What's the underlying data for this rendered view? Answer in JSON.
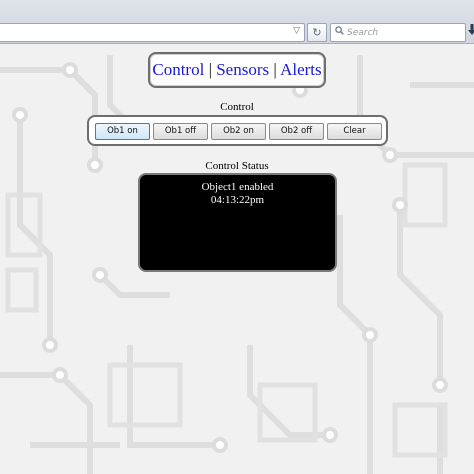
{
  "browser": {
    "search_placeholder": "Search",
    "reload_glyph": "↻",
    "dropdown_glyph": "▽",
    "search_icon": "magnifier-icon",
    "download_icon": "download-icon"
  },
  "nav": {
    "items": [
      {
        "label": "Control"
      },
      {
        "label": "Sensors"
      },
      {
        "label": "Alerts"
      }
    ],
    "separator": "|",
    "link_color": "#1a1ad8"
  },
  "control": {
    "title": "Control",
    "buttons": [
      {
        "label": "Ob1 on"
      },
      {
        "label": "Ob1 off"
      },
      {
        "label": "Ob2 on"
      },
      {
        "label": "Ob2 off"
      },
      {
        "label": "Clear"
      }
    ]
  },
  "status": {
    "title": "Control Status",
    "lines": [
      "Object1 enabled",
      "04:13:22pm"
    ]
  }
}
